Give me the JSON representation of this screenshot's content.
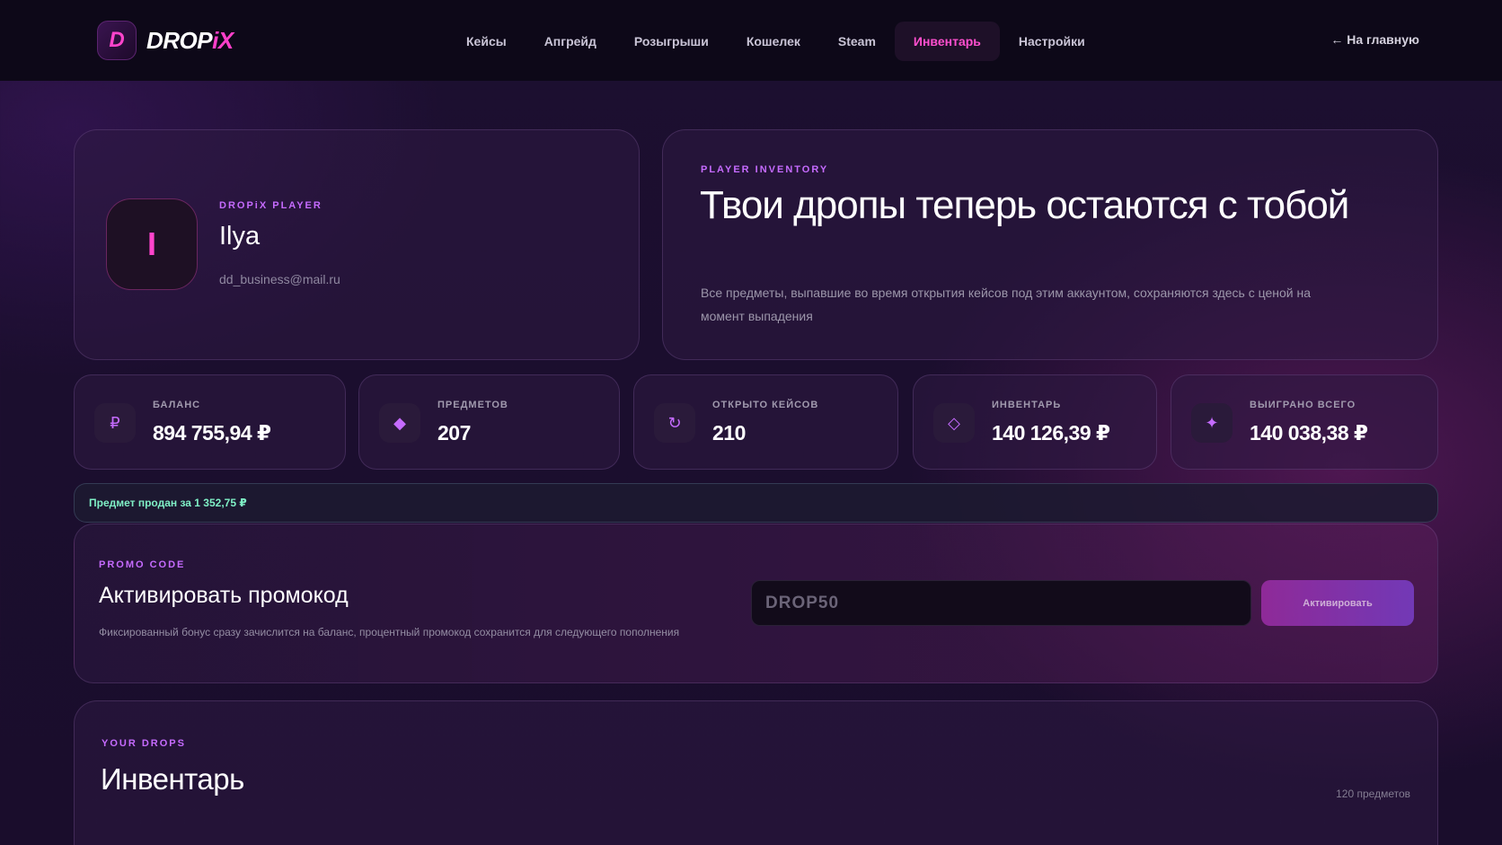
{
  "header": {
    "logo_letter": "D",
    "logo_drop": "DROP",
    "logo_ix": "iX",
    "nav": [
      {
        "label": "Кейсы"
      },
      {
        "label": "Апгрейд"
      },
      {
        "label": "Розыгрыши"
      },
      {
        "label": "Кошелек"
      },
      {
        "label": "Steam"
      },
      {
        "label": "Инвентарь",
        "active": true
      },
      {
        "label": "Настройки"
      }
    ],
    "back_label": "← На главную"
  },
  "profile": {
    "avatar_letter": "I",
    "eyebrow": "DROPiX PLAYER",
    "name": "Ilya",
    "email": "dd_business@mail.ru"
  },
  "hero": {
    "eyebrow": "PLAYER INVENTORY",
    "title": "Твои дропы теперь остаются с тобой",
    "description": "Все предметы, выпавшие во время открытия кейсов под этим аккаунтом, сохраняются здесь с ценой на момент выпадения"
  },
  "stats": [
    {
      "icon": "ruble-icon",
      "glyph": "₽",
      "label": "БАЛАНС",
      "value": "894 755,94 ₽"
    },
    {
      "icon": "diamond-filled-icon",
      "glyph": "◆",
      "label": "ПРЕДМЕТОВ",
      "value": "207"
    },
    {
      "icon": "refresh-icon",
      "glyph": "↻",
      "label": "ОТКРЫТО КЕЙСОВ",
      "value": "210"
    },
    {
      "icon": "diamond-outline-icon",
      "glyph": "◇",
      "label": "ИНВЕНТАРЬ",
      "value": "140 126,39 ₽"
    },
    {
      "icon": "sparkle-icon",
      "glyph": "✦",
      "label": "ВЫИГРАНО ВСЕГО",
      "value": "140 038,38 ₽"
    }
  ],
  "notice": {
    "text": "Предмет продан за 1 352,75 ₽",
    "color": "#7ff0c6"
  },
  "promo": {
    "eyebrow": "PROMO CODE",
    "title": "Активировать промокод",
    "description": "Фиксированный бонус сразу зачислится на баланс, процентный промокод сохранится для следующего пополнения",
    "input_placeholder": "DROP50",
    "button_label": "Активировать"
  },
  "inventory": {
    "eyebrow": "YOUR DROPS",
    "title": "Инвентарь",
    "count_label": "120 предметов"
  },
  "colors": {
    "accent_pink": "#ff3fc9",
    "accent_purple": "#c66bff",
    "background": "#1a0d2c"
  }
}
